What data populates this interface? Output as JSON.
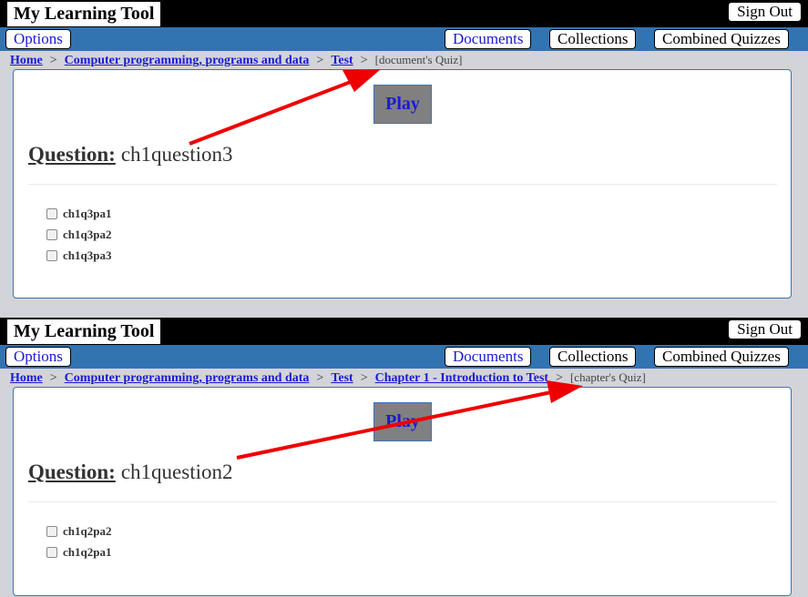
{
  "panels": [
    {
      "app_title": "My Learning Tool",
      "signout_label": "Sign Out",
      "options_label": "Options",
      "nav": {
        "documents": "Documents",
        "collections": "Collections",
        "combined": "Combined Quizzes"
      },
      "breadcrumb": {
        "home": "Home",
        "item1": "Computer programming, programs and data",
        "item2": "Test",
        "current": "[document's Quiz]"
      },
      "play_label": "Play",
      "question_label": "Question:",
      "question_text": "ch1question3",
      "options": [
        "ch1q3pa1",
        "ch1q3pa2",
        "ch1q3pa3"
      ]
    },
    {
      "app_title": "My Learning Tool",
      "signout_label": "Sign Out",
      "options_label": "Options",
      "nav": {
        "documents": "Documents",
        "collections": "Collections",
        "combined": "Combined Quizzes"
      },
      "breadcrumb": {
        "home": "Home",
        "item1": "Computer programming, programs and data",
        "item2": "Test",
        "item3": "Chapter 1 - Introduction to Test",
        "current": "[chapter's Quiz]"
      },
      "play_label": "Play",
      "question_label": "Question:",
      "question_text": "ch1question2",
      "options": [
        "ch1q2pa2",
        "ch1q2pa1"
      ]
    }
  ],
  "colors": {
    "navbar": "#3273b2",
    "link": "#1a1ad1",
    "arrow": "#ee0000",
    "page_bg": "#d3d4d9"
  }
}
